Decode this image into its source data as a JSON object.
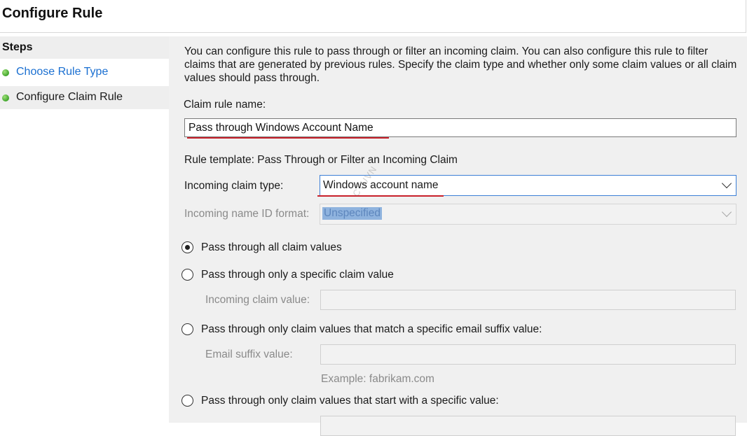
{
  "window": {
    "title": "Configure Rule"
  },
  "steps": {
    "header": "Steps",
    "items": [
      {
        "label": "Choose Rule Type",
        "state": "link"
      },
      {
        "label": "Configure Claim Rule",
        "state": "current"
      }
    ]
  },
  "main": {
    "description": "You can configure this rule to pass through or filter an incoming claim. You can also configure this rule to filter claims that are generated by previous rules. Specify the claim type and whether only some claim values or all claim values should pass through.",
    "claim_rule_name": {
      "label": "Claim rule name:",
      "value": "Pass through Windows Account Name"
    },
    "rule_template": "Rule template: Pass Through or Filter an Incoming Claim",
    "incoming_claim_type": {
      "label": "Incoming claim type:",
      "value": "Windows account name"
    },
    "incoming_name_id_format": {
      "label": "Incoming name ID format:",
      "value": "Unspecified",
      "enabled": false
    },
    "options": [
      {
        "label": "Pass through all claim values",
        "checked": true
      },
      {
        "label": "Pass through only a specific claim value",
        "checked": false,
        "sub_label": "Incoming claim value:",
        "sub_value": ""
      },
      {
        "label": "Pass through only claim values that match a specific email suffix value:",
        "checked": false,
        "sub_label": "Email suffix value:",
        "sub_value": "",
        "example": "Example: fabrikam.com"
      },
      {
        "label": "Pass through only claim values that start with a specific value:",
        "checked": false
      }
    ]
  },
  "watermark": "CTUVN",
  "colors": {
    "link": "#1a6fd1",
    "highlight_underline": "#c8202a",
    "focus_border": "#3c7fd6",
    "status_dot": "#3fa52a"
  }
}
